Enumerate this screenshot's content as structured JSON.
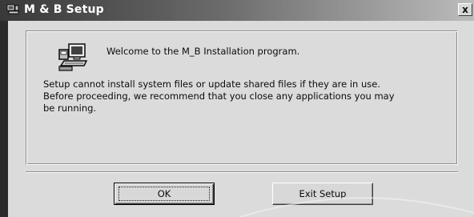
{
  "window": {
    "title": "M & B Setup",
    "close_label": "x"
  },
  "content": {
    "welcome_text": "Welcome to the M_B Installation program.",
    "message_lines": [
      "Setup cannot install system files or update shared files if they are in use.",
      "Before proceeding, we recommend that you close any applications you may",
      "be running."
    ]
  },
  "buttons": {
    "ok_label": "OK",
    "exit_label": "Exit Setup"
  },
  "icons": {
    "title_icon": "setup-computer-icon",
    "main_icon": "setup-computer-icon"
  }
}
